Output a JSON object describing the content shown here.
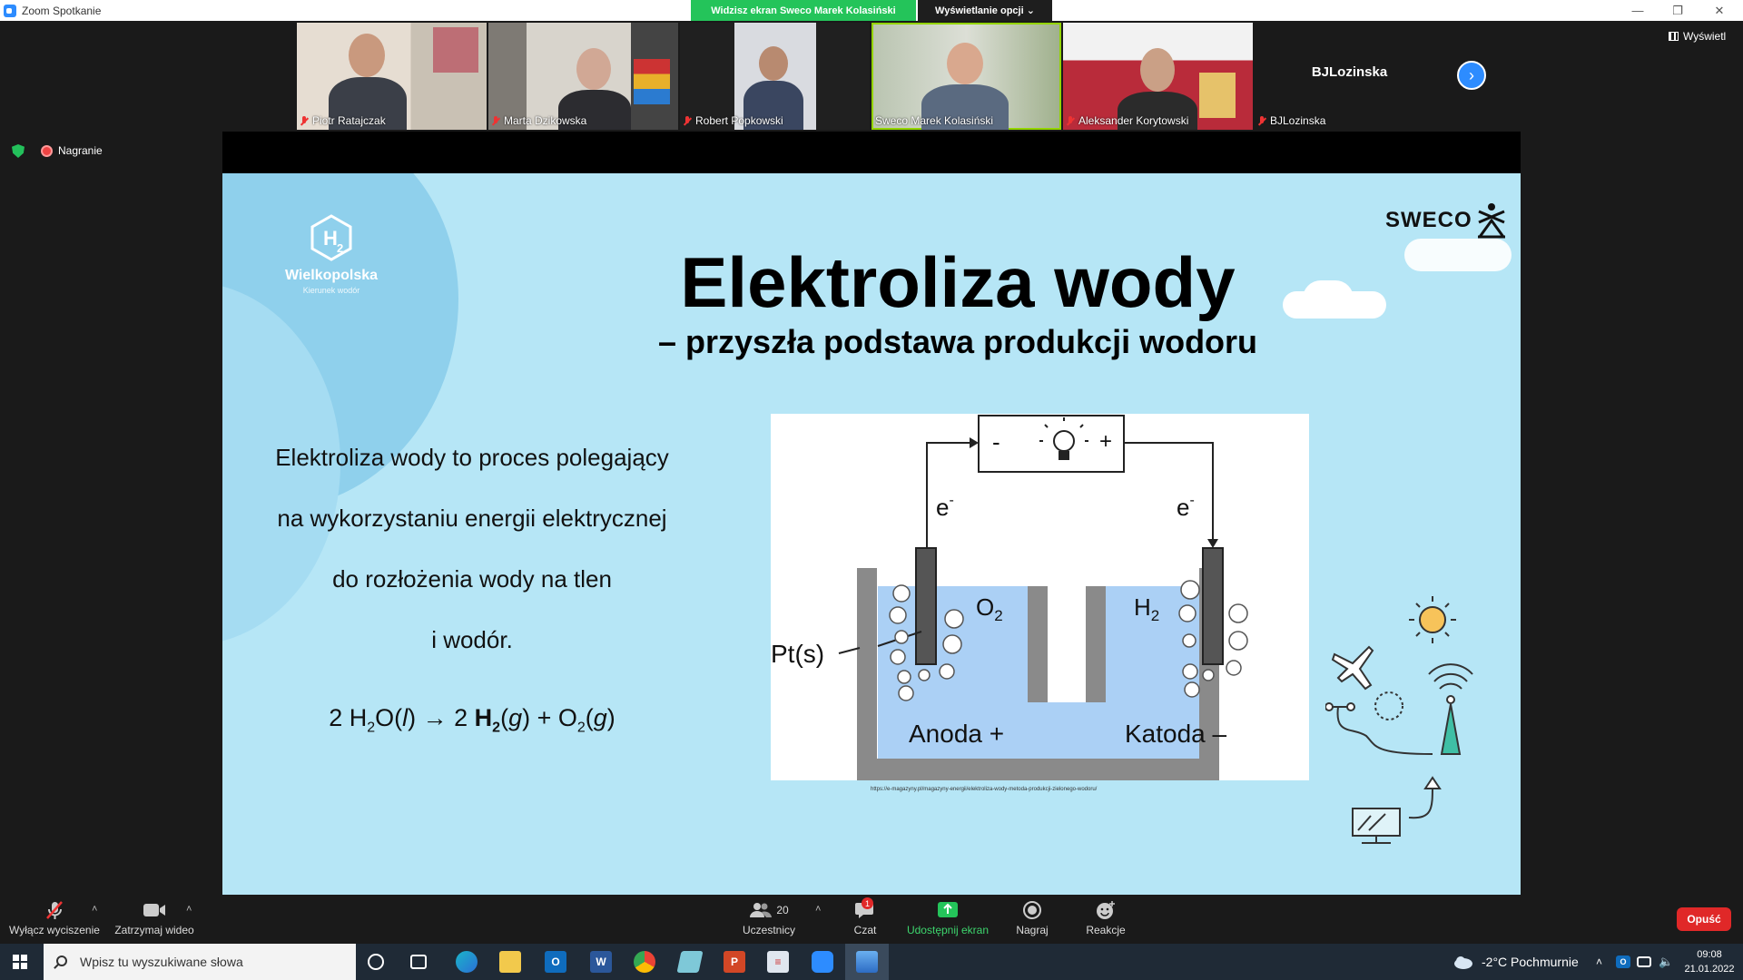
{
  "window": {
    "title": "Zoom Spotkanie",
    "sharing_banner": "Widzisz ekran Sweco Marek Kolasiński",
    "view_options": "Wyświetlanie opcji ⌄"
  },
  "participants": [
    {
      "name": "Piotr Ratajczak",
      "muted": true
    },
    {
      "name": "Marta Dzikowska",
      "muted": true
    },
    {
      "name": "Robert Popkowski",
      "muted": true
    },
    {
      "name": "Sweco Marek Kolasiński",
      "muted": false,
      "active": true
    },
    {
      "name": "Aleksander Korytowski",
      "muted": true
    },
    {
      "name": "BJLozinska",
      "muted": true,
      "video_off": true
    }
  ],
  "view_button": "Wyświetl",
  "recording": "Nagranie",
  "slide": {
    "logo_org": "Wielkopolska",
    "logo_tag": "Kierunek wodór",
    "brand": "SWECO",
    "title": "Elektroliza wody",
    "subtitle": "– przyszła podstawa produkcji wodoru",
    "body_lines": [
      "Elektroliza wody to proces polegający",
      "na wykorzystaniu energii elektrycznej",
      "do rozłożenia wody na tlen",
      "i wodór."
    ],
    "equation": {
      "p1": "2 H",
      "s1": "2",
      "p2": "O(",
      "l": "l",
      "p3": ") → 2 ",
      "h2": "H",
      "s2": "2",
      "p4": "(",
      "g1": "g",
      "p5": ") + O",
      "s3": "2",
      "p6": "(",
      "g2": "g",
      "p7": ")"
    },
    "diagram": {
      "minus": "-",
      "plus": "+",
      "electron_left": "e",
      "electron_right": "e",
      "electron_sup": "-",
      "o2": "O",
      "h2": "H",
      "sub2": "2",
      "electrode": "Pt(s)",
      "anode": "Anoda +",
      "cathode": "Katoda –"
    },
    "source": "https://e-magazyny.pl/magazyny-energii/elektroliza-wody-metoda-produkcji-zielonego-wodoru/"
  },
  "toolbar": {
    "mute": "Wyłącz wyciszenie",
    "video": "Zatrzymaj wideo",
    "participants": "Uczestnicy",
    "participant_count": "20",
    "chat": "Czat",
    "chat_badge": "1",
    "share": "Udostępnij ekran",
    "record": "Nagraj",
    "reactions": "Reakcje",
    "leave": "Opuść"
  },
  "taskbar": {
    "search_placeholder": "Wpisz tu wyszukiwane słowa",
    "weather": "-2°C  Pochmurnie",
    "time": "09:08",
    "date": "21.01.2022"
  },
  "colors": {
    "zoom_blue": "#2d8cff",
    "share_green": "#24c45a",
    "leave_red": "#e02828",
    "slide_bg": "#b6e6f6"
  }
}
